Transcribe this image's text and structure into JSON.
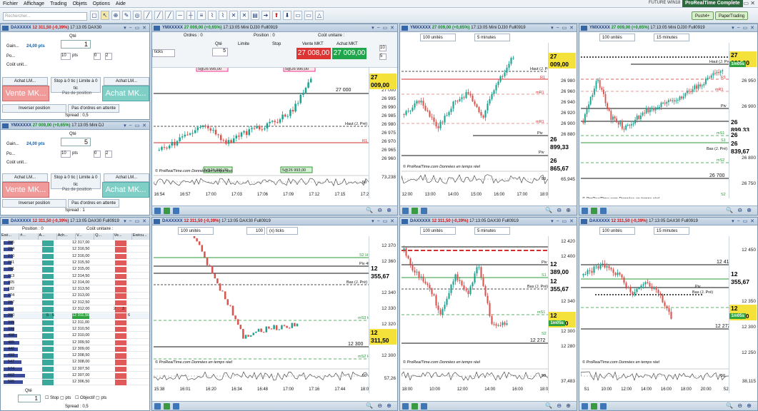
{
  "menu": {
    "items": [
      "Fichier",
      "Affichage",
      "Trading",
      "Objets",
      "Options",
      "Aide"
    ],
    "product": "FUTURE WIN18",
    "brand": "ProRealTime Complete",
    "wc": "_ ▭ ✕"
  },
  "toolbar": {
    "search_placeholder": "Rechercher...",
    "push_label": "Push4+",
    "paper_label": "PaperTrading"
  },
  "colors": {
    "up": "#1aa38f",
    "down": "#d9534f",
    "header": "#c3d3e4",
    "accent": "#f4e23b",
    "green": "#2fa33f"
  },
  "tl": {
    "title": "DAXXXXX",
    "change": "12 311,50 (-0,39%)",
    "time": "17:13:05 DAX30",
    "qty_label": "Qté",
    "qty": "1",
    "gain_label": "Gain...",
    "gain_val": "24,00 pts",
    "po_label": "Po...",
    "cout_label": "Coût unit...",
    "pts_label": "pts",
    "stop_label": "Stop à 0 tic",
    "limit_label": "Limite à 0 tic",
    "achat_lm": "Achat LM...",
    "vente_lm": "Achat LM...",
    "achat_lm2": "Achat LM...",
    "vente_mkt": "Vente MK...",
    "pas_position": "Pas de position",
    "achat_mkt": "Achat MK...",
    "inverser": "Inverser position",
    "pas_ordres": "Pas d'ordres en attente",
    "spread": "Spread : 0,5",
    "n10": "10",
    "n0": "0",
    "n2": "2"
  },
  "ml": {
    "title": "YMXXXXX",
    "change": "27 009,00 (+0,65%)",
    "time": "17:13:05 Mini DJ",
    "qty_label": "Qté",
    "qty": "5",
    "gain_label": "Gain...",
    "gain_val": "24,00 pts",
    "po_label": "Po...",
    "cout_label": "Coût unit...",
    "pts_label": "pts",
    "stop_label": "Stop à 0 tic",
    "limit_label": "Limite à 0 tic",
    "achat_lm": "Achat LM...",
    "vente_lm": "Achat LM...",
    "achat_lm2": "Achat LM...",
    "vente_mkt": "Vente MK...",
    "pas_position": "Pas de position",
    "achat_mkt": "Achat MK...",
    "inverser": "Inverser position",
    "pas_ordres": "Pas d'ordres en attente",
    "spread": "Spread : 1",
    "n10": "10",
    "n0": "0",
    "n2": "2"
  },
  "bl": {
    "title": "DAXXXXX",
    "change": "12 311,50 (-0,39%)",
    "time": "17:13:05 DAX30 Full0919",
    "position_label": "Position : 0",
    "cout_label": "Coût unitaire :",
    "cols": [
      "Exé...",
      "#...",
      "A...",
      "Ach...",
      "V...",
      "Q...",
      "Ve...",
      "Exécu..."
    ],
    "rows": [
      [
        "295",
        "12 317,00"
      ],
      [
        "294",
        "12 316,50"
      ],
      [
        "276",
        "12 316,00"
      ],
      [
        "231",
        "12 315,50"
      ],
      [
        "291",
        "12 315,00"
      ],
      [
        "213",
        "12 314,50"
      ],
      [
        "205",
        "12 314,00"
      ],
      [
        "182",
        "12 313,50"
      ],
      [
        "224",
        "12 313,00"
      ],
      [
        "287",
        "12 312,50"
      ],
      [
        "311",
        "12 312,00"
      ],
      [
        "290",
        "12 311,50"
      ],
      [
        "335",
        "12 311,00"
      ],
      [
        "330",
        "12 310,50"
      ],
      [
        "408",
        "12 310,00"
      ],
      [
        "485",
        "12 309,50"
      ],
      [
        "440",
        "12 309,00"
      ],
      [
        "432",
        "12 308,50"
      ],
      [
        "547",
        "12 308,00"
      ],
      [
        "574",
        "12 307,50"
      ],
      [
        "662",
        "12 307,00"
      ],
      [
        "595",
        "12 306,50"
      ]
    ],
    "qty_label": "Qté",
    "qty": "1",
    "stop_label": "Stop",
    "pts_label": "pts",
    "obj_label": "Objectif",
    "obj_pts": "pts",
    "spread": "Spread : 0,5",
    "r1": "5",
    "r2": "5",
    "r3": "2",
    "r4": "3",
    "r5": "6"
  },
  "tc": {
    "title": "YMXXXXX",
    "change": "27 009,00 (+0,65%)",
    "time": "17:13:05 Mini DJ30 Full0919",
    "ordres": "Ordres : 0",
    "position": "Position : 0",
    "cout": "Coût unitaire :",
    "qty_label": "Qté",
    "qty": "5",
    "limite": "Limite",
    "stop": "Stop",
    "vente_label": "Vente MKT",
    "achat_label": "Achat MKT",
    "vente_price": "27 008,00",
    "achat_price": "27 009,00",
    "ticks": "ticks",
    "box1": "10",
    "box2": "5",
    "buy_label1": "5@26 995,00",
    "buy_label2": "5@26 990,00",
    "buy_label3": "5@26 990,00",
    "buy_label4": "5@26 993,00",
    "haut": "Haut (J. Pré)",
    "r1": "R1",
    "price": "27 009,00",
    "copy": "© ProRealTime.com  Données en temps réel",
    "ind": "73,238",
    "ind50": "50",
    "yl": [
      "27 000",
      "26 995",
      "26 990",
      "26 985",
      "26 980",
      "26 975",
      "26 970",
      "26 965",
      "26 960"
    ],
    "xl": [
      "16:54",
      "16:57",
      "17:00",
      "17:03",
      "17:06",
      "17:09",
      "17:12",
      "17:15",
      "17:21"
    ]
  },
  "tm": {
    "title": "YMXXXXX",
    "change": "27 009,00 (+0,65%)",
    "time": "17:13:05 Mini DJ30 Full0919",
    "units": "100 unités",
    "period": "5 minutes",
    "haut": "Haut (J. Pré)",
    "r1": "R1",
    "mr1": "mR1",
    "mr1b": "mR1",
    "piv": "Piv",
    "piv2": "Piv",
    "price": "27 009,00",
    "lv1": "26 899,33",
    "lv2": "26 865,67",
    "copy": "© ProRealTime.com  Données en temps réel",
    "ind": "65,945",
    "ind50": "50",
    "yl": [
      "26 980",
      "26 960",
      "26 940",
      "26 920",
      "26 900",
      "26 880",
      "26 860"
    ],
    "xl": [
      "12:00",
      "13:00",
      "14:00",
      "15:00",
      "16:00",
      "17:00",
      "18:00"
    ]
  },
  "tr": {
    "title": "YMXXXXX",
    "change": "27 009,00 (+0,65%)",
    "time": "17:13:05 Mini DJ30 Full0919",
    "units": "100 unités",
    "period": "15 minutes",
    "haut": "Haut (J. Pré)",
    "price": "27 009,00",
    "tagg": "1m05s",
    "lv1": "26 899,33",
    "lv2": "26 865,67",
    "lv3": "26 839,67",
    "lv4": "26 700",
    "r1": "R1",
    "mr1": "mR1",
    "piv": "Piv",
    "s1": "S1",
    "ms1": "mS1",
    "bas": "Bas (J. Pré)",
    "ms2": "mS2",
    "s2": "S2",
    "copy": "© ProRealTime.com  Données en temps réel",
    "yl": [
      "26 950",
      "26 900",
      "26 850",
      "26 800",
      "26 750"
    ],
    "xl": [
      "16:00",
      "19:00",
      "22:00",
      "S1",
      "04:00",
      "07:00",
      "10:00",
      "13:00",
      "16:00"
    ]
  },
  "bc": {
    "title": "DAXXXXX",
    "change": "12 311,50 (-0,39%)",
    "time": "17:13:05 DAX30 Full0919",
    "units": "100 unités",
    "period": "(x) ticks",
    "ticksnum": "100",
    "price": "12 311,50",
    "lv1": "12 355,67",
    "lv2": "12 300",
    "r2": "S2 H",
    "piv": "Piv 4H",
    "ms3": "mS3 H",
    "ms2": "mS2 H",
    "bas": "Bas (J. Pré)",
    "copy": "© ProRealTime.com  Données en temps réel",
    "ind": "57,26",
    "ind50": "50",
    "yl": [
      "12 370",
      "12 360",
      "12 350",
      "12 340",
      "12 330",
      "12 320",
      "12 310",
      "12 300"
    ],
    "xl": [
      "15:38",
      "16:01",
      "16:20",
      "16:34",
      "16:48",
      "17:00",
      "17:16",
      "17:44",
      "18:00"
    ]
  },
  "bm": {
    "title": "DAXXXXX",
    "change": "12 311,50 (-0,39%)",
    "time": "17:13:05 DAX30 Full0919",
    "units": "100 unités",
    "period": "5 minutes",
    "price": "12 311,50",
    "tagg": "1m05s",
    "lv1": "12 389,00",
    "lv2": "12 355,67",
    "lv3": "12 272",
    "bas": "Bas (J. Pré)",
    "piv": "Piv",
    "s1": "S1",
    "ms1": "mS1",
    "s2": "S2",
    "copy": "© ProRealTime.com  Données en temps réel",
    "ind": "37,483",
    "ind50": "50",
    "yl": [
      "12 420",
      "12 400",
      "12 380",
      "12 360",
      "12 340",
      "12 320",
      "12 300",
      "12 280"
    ],
    "xl": [
      "18:00",
      "10:00",
      "12:00",
      "14:00",
      "16:00",
      "18:00"
    ]
  },
  "br": {
    "title": "DAXXXXX",
    "change": "12 311,50 (-0,39%)",
    "time": "17:13:05 DAX30 Full0919",
    "units": "100 unités",
    "period": "15 minutes",
    "price": "12 311,50",
    "tagg": "1m05s",
    "lv1": "12 412",
    "lv2": "12 355,67",
    "lv3": "12 272",
    "bas": "Bas (J. Pré)",
    "piv": "Piv",
    "copy": "© ProRealTime.com  Données en temps réel",
    "ind": "38,115",
    "ind50": "50",
    "yl": [
      "12 450",
      "12 400",
      "12 350",
      "12 300",
      "12 250"
    ],
    "xl": [
      "S1",
      "10:00",
      "12:00",
      "14:00",
      "16:00",
      "18:00",
      "20:00",
      "S2"
    ]
  }
}
